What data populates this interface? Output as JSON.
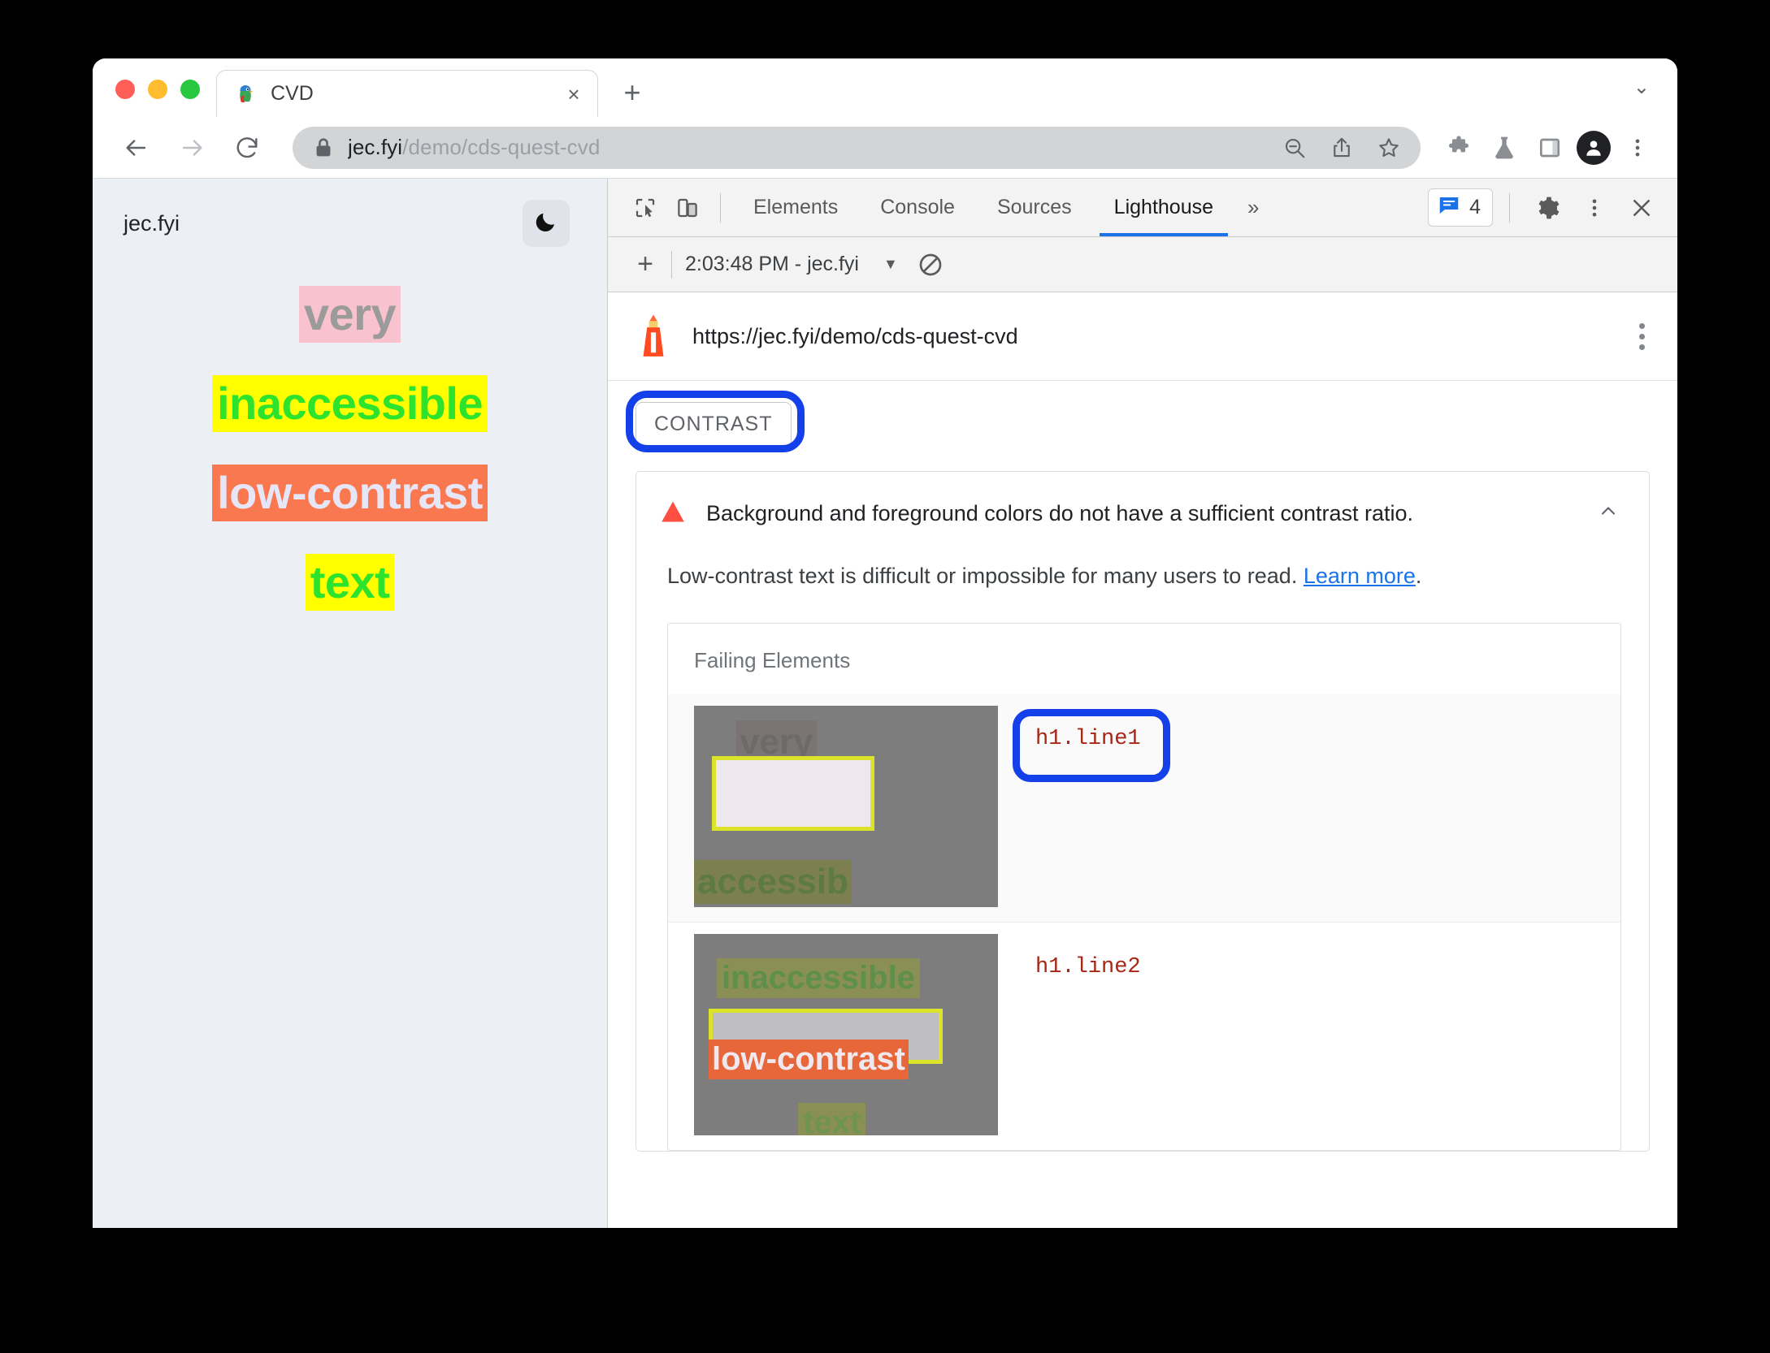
{
  "browser": {
    "tab": {
      "title": "CVD",
      "favicon": "parrot-favicon",
      "close_label": "×"
    },
    "new_tab_label": "+",
    "tabstrip_chevron": "⌄",
    "omnibox": {
      "url_host": "jec.fyi",
      "url_path": "/demo/cds-quest-cvd",
      "lock_icon": "lock-icon"
    },
    "toolbar_icons": [
      "zoom-out-icon",
      "share-icon",
      "bookmark-star-icon",
      "extensions-puzzle-icon",
      "labs-flask-icon",
      "side-panel-icon",
      "profile-avatar-icon",
      "browser-menu-icon"
    ],
    "nav": {
      "back": "←",
      "forward": "→",
      "reload": "↻"
    }
  },
  "page": {
    "site_name": "jec.fyi",
    "theme_toggle_icon": "moon-icon",
    "lines": [
      {
        "text": "very",
        "bg": "#f8c3cf",
        "fg": "#9b9b9b"
      },
      {
        "text": "inaccessible",
        "bg": "#ffff00",
        "fg": "#2ee32e"
      },
      {
        "text": "low-contrast",
        "bg": "#f97850",
        "fg": "#e6e6f7"
      },
      {
        "text": "text",
        "bg": "#ffff00",
        "fg": "#2ee32e"
      }
    ]
  },
  "devtools": {
    "inspect_icon": "inspect-cursor-icon",
    "device_icon": "device-toolbar-icon",
    "tabs": [
      {
        "label": "Elements",
        "active": false
      },
      {
        "label": "Console",
        "active": false
      },
      {
        "label": "Sources",
        "active": false
      },
      {
        "label": "Lighthouse",
        "active": true
      }
    ],
    "more_tabs_label": "»",
    "issues": {
      "count": "4",
      "icon": "issues-message-icon"
    },
    "settings_icon": "gear-icon",
    "menu_icon": "devtools-menu-icon",
    "close_icon": "close-icon",
    "subbar": {
      "add_label": "+",
      "run_label": "2:03:48 PM - jec.fyi",
      "dropdown_caret": "▼",
      "clear_icon": "no-entry-icon"
    }
  },
  "report": {
    "logo": "lighthouse-logo",
    "url": "https://jec.fyi/demo/cds-quest-cvd",
    "kebab_icon": "report-menu-icon",
    "category_chip": "CONTRAST",
    "audit": {
      "warning_icon": "warning-triangle-icon",
      "title": "Background and foreground colors do not have a sufficient contrast ratio.",
      "collapse_icon": "chevron-up-icon",
      "description_before": "Low-contrast text is difficult or impossible for many users to read. ",
      "learn_more": "Learn more",
      "description_after": "."
    },
    "failing_elements_title": "Failing Elements",
    "failing_elements": [
      {
        "selector": "h1.line1",
        "annotated": true,
        "thumb": {
          "above": "very",
          "below": "accessib",
          "highlight": "line1-highlight"
        }
      },
      {
        "selector": "h1.line2",
        "annotated": false,
        "thumb": {
          "above": "inaccessible",
          "middle": "low-contrast",
          "below": "text",
          "highlight": "line2-highlight"
        }
      }
    ]
  },
  "annotations": {
    "ring_color": "#1340e8",
    "targets": [
      "CONTRAST",
      "h1.line1"
    ]
  }
}
